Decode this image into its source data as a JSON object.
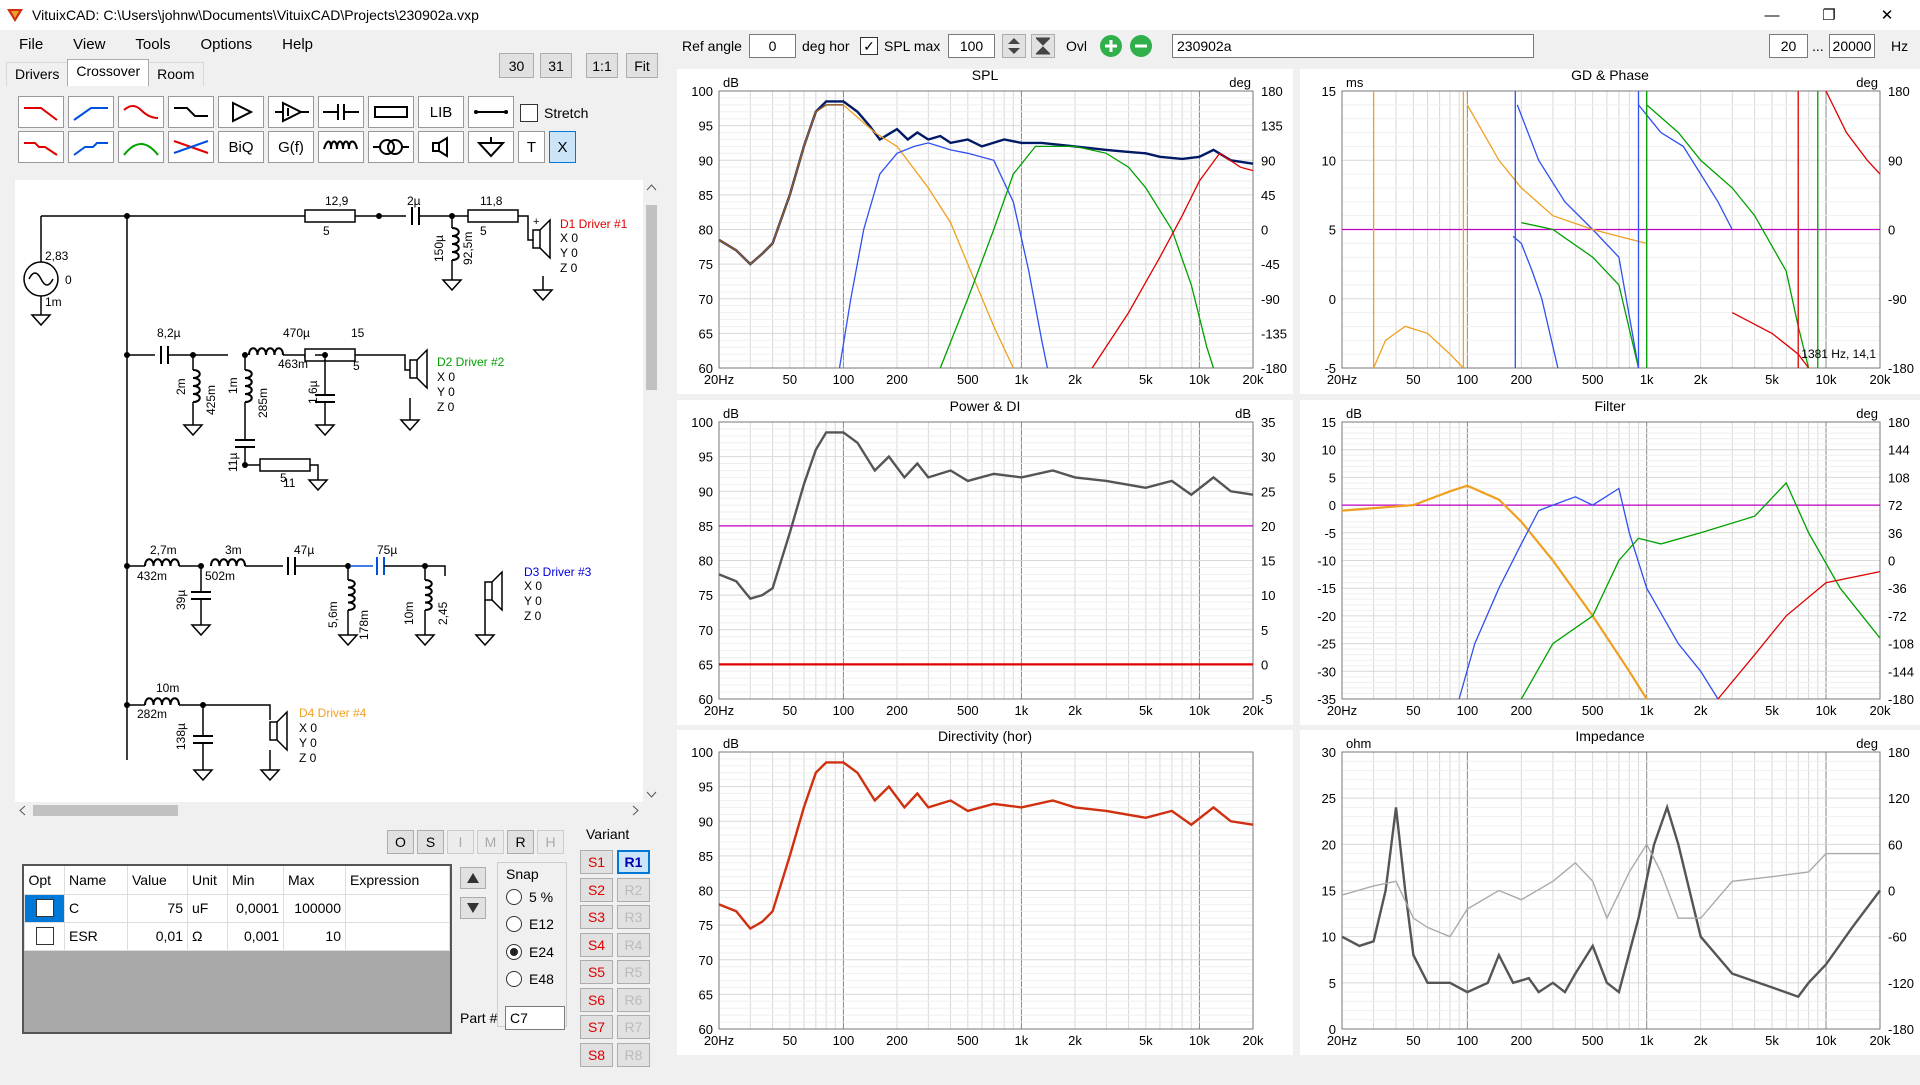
{
  "window": {
    "title": "VituixCAD: C:\\Users\\johnw\\Documents\\VituixCAD\\Projects\\230902a.vxp",
    "minimize": "—",
    "maximize": "❐",
    "close": "✕"
  },
  "menu": [
    "File",
    "View",
    "Tools",
    "Options",
    "Help"
  ],
  "zoom_buttons": [
    "30",
    "31",
    "1:1",
    "Fit"
  ],
  "tabs": [
    "Drivers",
    "Crossover",
    "Room"
  ],
  "toolbox": {
    "row1_text": [
      "LIB"
    ],
    "row2_text": [
      "BiQ",
      "G(f)",
      "T",
      "X"
    ],
    "stretch_label": "Stretch"
  },
  "schematic": {
    "texts": [
      {
        "t": "12,9"
      },
      {
        "t": "5"
      },
      {
        "t": "2µ"
      },
      {
        "t": "11,8"
      },
      {
        "t": "5"
      },
      {
        "t": "150µ"
      },
      {
        "t": "92,5m"
      },
      {
        "t": "D1 Driver #1"
      },
      {
        "t": "X 0"
      },
      {
        "t": "Y 0"
      },
      {
        "t": "Z 0"
      },
      {
        "t": "2,83"
      },
      {
        "t": "0"
      },
      {
        "t": "1m"
      },
      {
        "t": "8,2µ"
      },
      {
        "t": "470µ"
      },
      {
        "t": "463m"
      },
      {
        "t": "15"
      },
      {
        "t": "5"
      },
      {
        "t": "2m"
      },
      {
        "t": "425m"
      },
      {
        "t": "1m"
      },
      {
        "t": "285m"
      },
      {
        "t": "1,6µ"
      },
      {
        "t": "D2 Driver #2"
      },
      {
        "t": "X 0"
      },
      {
        "t": "Y 0"
      },
      {
        "t": "Z 0"
      },
      {
        "t": "11µ"
      },
      {
        "t": "11"
      },
      {
        "t": "5"
      },
      {
        "t": "2,7m"
      },
      {
        "t": "432m"
      },
      {
        "t": "3m"
      },
      {
        "t": "502m"
      },
      {
        "t": "47µ"
      },
      {
        "t": "75µ"
      },
      {
        "t": "39µ"
      },
      {
        "t": "5,6m"
      },
      {
        "t": "178m"
      },
      {
        "t": "10m"
      },
      {
        "t": "2,45"
      },
      {
        "t": "D3 Driver #3"
      },
      {
        "t": "X 0"
      },
      {
        "t": "Y 0"
      },
      {
        "t": "Z 0"
      },
      {
        "t": "10m"
      },
      {
        "t": "282m"
      },
      {
        "t": "138µ"
      },
      {
        "t": "D4 Driver #4"
      },
      {
        "t": "X 0"
      },
      {
        "t": "Y 0"
      },
      {
        "t": "Z 0"
      }
    ],
    "driver_colors": {
      "d1": "#e00000",
      "d2": "#00a000",
      "d3": "#0000e0",
      "d4": "#f0a020"
    }
  },
  "opt_buttons": [
    "O",
    "S",
    "I",
    "M",
    "R",
    "H"
  ],
  "param_table": {
    "headers": [
      "Opt",
      "Name",
      "Value",
      "Unit",
      "Min",
      "Max",
      "Expression"
    ],
    "rows": [
      {
        "name": "C",
        "value": "75",
        "unit": "uF",
        "min": "0,0001",
        "max": "100000",
        "expr": ""
      },
      {
        "name": "ESR",
        "value": "0,01",
        "unit": "Ω",
        "min": "0,001",
        "max": "10",
        "expr": ""
      }
    ]
  },
  "snap": {
    "label": "Snap",
    "options": [
      "5 %",
      "E12",
      "E24",
      "E48"
    ],
    "selected": "E24"
  },
  "part": {
    "label": "Part #",
    "value": "C7"
  },
  "variant": {
    "label": "Variant",
    "s": [
      "S1",
      "S2",
      "S3",
      "S4",
      "S5",
      "S6",
      "S7",
      "S8"
    ],
    "r": [
      "R1",
      "R2",
      "R3",
      "R4",
      "R5",
      "R6",
      "R7",
      "R8"
    ],
    "active": "R1"
  },
  "top_controls": {
    "ref_angle_label": "Ref angle",
    "ref_angle": "0",
    "deg_hor": "deg hor",
    "spl_max_label": "SPL max",
    "spl_max": "100",
    "ovl_label": "Ovl",
    "overlay_name": "230902a",
    "f_min": "20",
    "dots": "...",
    "f_max": "20000",
    "hz": "Hz"
  },
  "x_ticks": [
    "20Hz",
    "50",
    "100",
    "200",
    "500",
    "1k",
    "2k",
    "5k",
    "10k",
    "20k"
  ],
  "charts": {
    "spl": {
      "title": "SPL",
      "left_unit": "dB",
      "right_unit": "deg",
      "left": [
        "100",
        "95",
        "90",
        "85",
        "80",
        "75",
        "70",
        "65",
        "60"
      ],
      "right": [
        "180",
        "135",
        "90",
        "45",
        "0",
        "-45",
        "-90",
        "-135",
        "-180"
      ]
    },
    "gd": {
      "title": "GD & Phase",
      "left_unit": "ms",
      "right_unit": "deg",
      "left": [
        "15",
        "10",
        "5",
        "0",
        "-5"
      ],
      "right": [
        "180",
        "90",
        "0",
        "-90",
        "-180"
      ],
      "cursor": "1381 Hz, 14,1"
    },
    "power": {
      "title": "Power & DI",
      "left_unit": "dB",
      "right_unit": "dB",
      "left": [
        "100",
        "95",
        "90",
        "85",
        "80",
        "75",
        "70",
        "65",
        "60"
      ],
      "right": [
        "35",
        "30",
        "25",
        "20",
        "15",
        "10",
        "5",
        "0",
        "-5"
      ]
    },
    "filter": {
      "title": "Filter",
      "left_unit": "dB",
      "right_unit": "deg",
      "left": [
        "15",
        "10",
        "5",
        "0",
        "-5",
        "-10",
        "-15",
        "-20",
        "-25",
        "-30",
        "-35"
      ],
      "right": [
        "180",
        "144",
        "108",
        "72",
        "36",
        "0",
        "-36",
        "-72",
        "-108",
        "-144",
        "-180"
      ]
    },
    "dir": {
      "title": "Directivity (hor)",
      "left_unit": "dB",
      "right_unit": "",
      "left": [
        "100",
        "95",
        "90",
        "85",
        "80",
        "75",
        "70",
        "65",
        "60"
      ],
      "right": []
    },
    "imp": {
      "title": "Impedance",
      "left_unit": "ohm",
      "right_unit": "deg",
      "left": [
        "30",
        "25",
        "20",
        "15",
        "10",
        "5",
        "0"
      ],
      "right": [
        "180",
        "120",
        "60",
        "0",
        "-60",
        "-120",
        "-180"
      ]
    }
  },
  "curve_colors": {
    "total": "#001a66",
    "tw": "#e00000",
    "mid": "#00a000",
    "mid2": "#3050f0",
    "woof": "#f0a020",
    "magenta": "#c000c0",
    "gray": "#555555"
  }
}
